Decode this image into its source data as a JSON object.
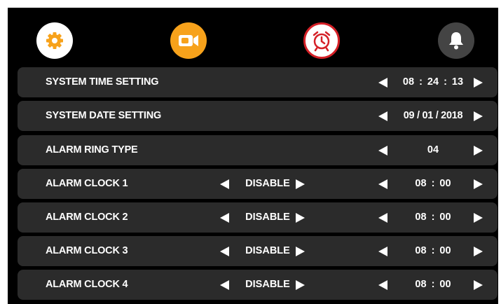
{
  "topbar": {
    "icons": [
      {
        "name": "gear-icon",
        "color": "#f7a21b"
      },
      {
        "name": "video-camera-icon",
        "color": "#ffffff"
      },
      {
        "name": "alarm-clock-icon",
        "color": "#d52027"
      },
      {
        "name": "bell-icon",
        "color": "#ffffff"
      }
    ]
  },
  "rows": [
    {
      "label": "SYSTEM TIME SETTING",
      "value": "08 : 24 : 13"
    },
    {
      "label": "SYSTEM DATE SETTING",
      "value": "09 / 01 / 2018"
    },
    {
      "label": "ALARM RING TYPE",
      "value": "04"
    },
    {
      "label": "ALARM CLOCK 1",
      "status": "DISABLE",
      "value": "08 : 00"
    },
    {
      "label": "ALARM CLOCK 2",
      "status": "DISABLE",
      "value": "08 : 00"
    },
    {
      "label": "ALARM CLOCK 3",
      "status": "DISABLE",
      "value": "08 : 00"
    },
    {
      "label": "ALARM CLOCK 4",
      "status": "DISABLE",
      "value": "08 : 00"
    }
  ],
  "colors": {
    "background": "#000000",
    "row_background": "#2b2b2b",
    "accent_orange": "#f7a21b",
    "accent_red": "#d52027"
  }
}
